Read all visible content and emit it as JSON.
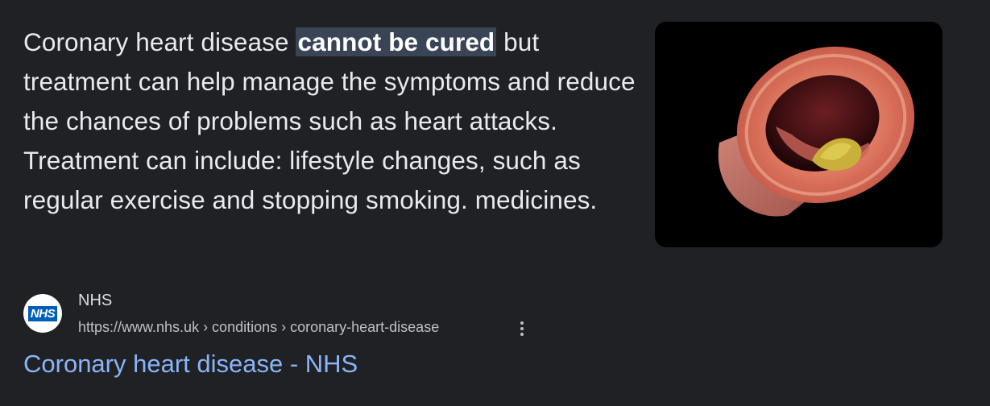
{
  "snippet": {
    "before": "Coronary heart disease ",
    "highlight": "cannot be cured",
    "after": " but treatment can help manage the symptoms and reduce the chances of problems such as heart attacks. Treatment can include: lifestyle changes, such as regular exercise and stopping smoking. medicines."
  },
  "image": {
    "icon": "artery-cross-section-image"
  },
  "source": {
    "logo_text": "NHS",
    "name": "NHS",
    "url": "https://www.nhs.uk › conditions › coronary-heart-disease",
    "menu_icon": "more-vert-icon"
  },
  "result": {
    "title": "Coronary heart disease - NHS"
  },
  "colors": {
    "background": "#202124",
    "text": "#e8eaed",
    "highlight_bg": "#394457",
    "link": "#8ab4f8",
    "nhs_blue": "#005eb8"
  }
}
